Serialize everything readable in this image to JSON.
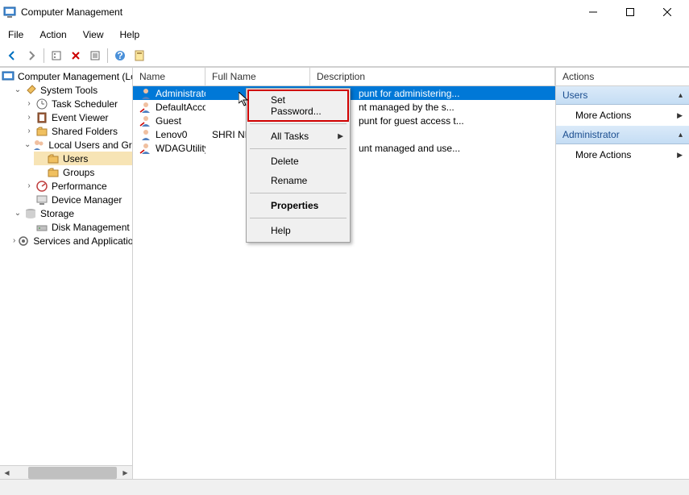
{
  "window": {
    "title": "Computer Management"
  },
  "menubar": {
    "file": "File",
    "action": "Action",
    "view": "View",
    "help": "Help"
  },
  "tree": {
    "root": "Computer Management (Local",
    "system_tools": "System Tools",
    "task_scheduler": "Task Scheduler",
    "event_viewer": "Event Viewer",
    "shared_folders": "Shared Folders",
    "local_users": "Local Users and Groups",
    "users": "Users",
    "groups": "Groups",
    "performance": "Performance",
    "device_manager": "Device Manager",
    "storage": "Storage",
    "disk_management": "Disk Management",
    "services_apps": "Services and Applications"
  },
  "list": {
    "header_name": "Name",
    "header_fullname": "Full Name",
    "header_desc": "Description",
    "rows": [
      {
        "name": "Administrator",
        "fullname": "",
        "desc": "punt for administering..."
      },
      {
        "name": "DefaultAcco...",
        "fullname": "",
        "desc": "nt managed by the s..."
      },
      {
        "name": "Guest",
        "fullname": "",
        "desc": "punt for guest access t..."
      },
      {
        "name": "Lenov0",
        "fullname": "SHRI NID",
        "desc": ""
      },
      {
        "name": "WDAGUtility...",
        "fullname": "",
        "desc": "unt managed and use..."
      }
    ]
  },
  "context_menu": {
    "set_password": "Set Password...",
    "all_tasks": "All Tasks",
    "delete": "Delete",
    "rename": "Rename",
    "properties": "Properties",
    "help": "Help"
  },
  "actions": {
    "header": "Actions",
    "section_users": "Users",
    "more_actions": "More Actions",
    "section_admin": "Administrator"
  }
}
